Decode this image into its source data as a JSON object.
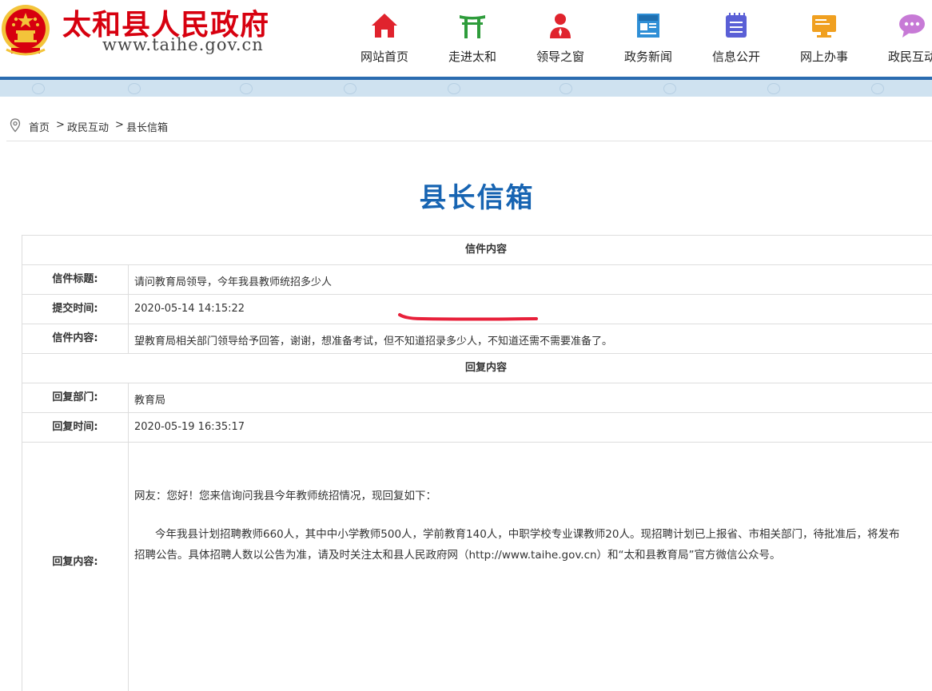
{
  "header": {
    "site_title": "太和县人民政府",
    "site_url": "www.taihe.gov.cn",
    "title_color": "#d7000f",
    "nav": [
      {
        "label": "网站首页",
        "icon": "home-icon",
        "color": "#e0232d"
      },
      {
        "label": "走进太和",
        "icon": "gate-icon",
        "color": "#2e9c3b"
      },
      {
        "label": "领导之窗",
        "icon": "leader-icon",
        "color": "#e0232d"
      },
      {
        "label": "政务新闻",
        "icon": "news-icon",
        "color": "#2f8fd6"
      },
      {
        "label": "信息公开",
        "icon": "notebook-icon",
        "color": "#5a5fd6"
      },
      {
        "label": "网上办事",
        "icon": "computer-icon",
        "color": "#f0a020"
      },
      {
        "label": "政民互动",
        "icon": "chat-icon",
        "color": "#c77ad6"
      }
    ]
  },
  "breadcrumb": {
    "items": [
      "首页",
      "政民互动",
      "县长信箱"
    ],
    "separator": ">"
  },
  "page_title": "县长信箱",
  "letter": {
    "section_title": "信件内容",
    "fields": [
      {
        "label": "信件标题:",
        "value": "请问教育局领导，今年我县教师统招多少人"
      },
      {
        "label": "提交时间:",
        "value": "2020-05-14 14:15:22"
      },
      {
        "label": "信件内容:",
        "value": "望教育局相关部门领导给予回答，谢谢，想准备考试，但不知道招录多少人，不知道还需不需要准备了。"
      }
    ]
  },
  "reply": {
    "section_title": "回复内容",
    "department_label": "回复部门:",
    "department": "教育局",
    "time_label": "回复时间:",
    "time": "2020-05-19 16:35:17",
    "content_label": "回复内容:",
    "greeting": "网友：您好！您来信询问我县今年教师统招情况，现回复如下：",
    "body_line1": "今年我县计划招聘教师660人，其中中小学教师500人，学前教育140人，中职学校专业课教师20人。现招聘计划已上报省、市相关部门，待批准后，将发布",
    "body_line2": "招聘公告。具体招聘人数以公告为准，请及时关注太和县人民政府网（http://www.taihe.gov.cn）和“太和县教育局”官方微信公众号。"
  },
  "accent_color": "#1764b2"
}
